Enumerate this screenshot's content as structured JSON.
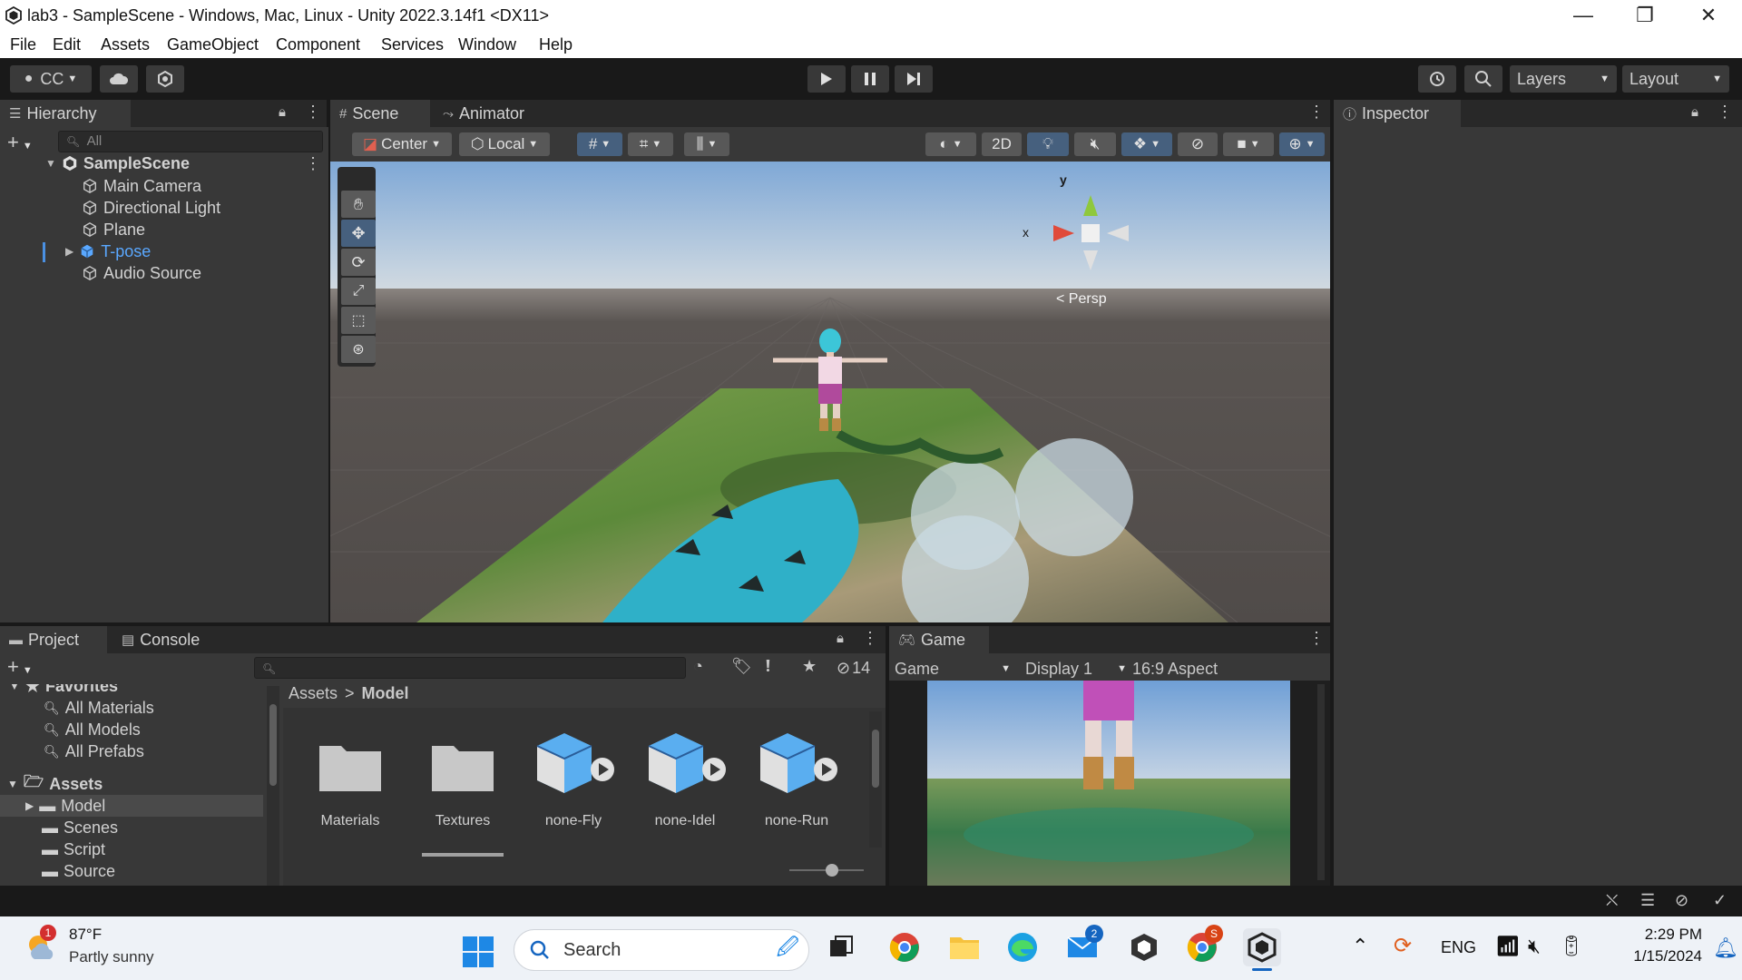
{
  "window": {
    "title": "lab3 - SampleScene - Windows, Mac, Linux - Unity 2022.3.14f1 <DX11>",
    "minimize_glyph": "—",
    "maximize_glyph": "❐",
    "close_glyph": "✕"
  },
  "menu": [
    "File",
    "Edit",
    "Assets",
    "GameObject",
    "Component",
    "Services",
    "Window",
    "Help"
  ],
  "toolbar": {
    "account_label": "CC",
    "layers_label": "Layers",
    "layout_label": "Layout"
  },
  "hierarchy": {
    "tab_label": "Hierarchy",
    "search_placeholder": "All",
    "scene_name": "SampleScene",
    "items": [
      "Main Camera",
      "Directional Light",
      "Plane",
      "T-pose",
      "Audio Source"
    ]
  },
  "scene_view": {
    "tabs": [
      "Scene",
      "Animator"
    ],
    "pivot_label": "Center",
    "space_label": "Local",
    "mode_2d_label": "2D",
    "gizmo_y": "y",
    "gizmo_x": "x",
    "persp_label": "< Persp"
  },
  "inspector": {
    "tab_label": "Inspector"
  },
  "project": {
    "tabs": [
      "Project",
      "Console"
    ],
    "hidden_count": "14",
    "favorites_header": "Favorites",
    "favorites": [
      "All Materials",
      "All Models",
      "All Prefabs"
    ],
    "assets_root": "Assets",
    "folders": [
      "Model",
      "Scenes",
      "Script",
      "Source"
    ],
    "breadcrumb": [
      "Assets",
      "Model"
    ],
    "breadcrumb_sep": ">",
    "items": [
      {
        "name": "Materials",
        "kind": "folder"
      },
      {
        "name": "Textures",
        "kind": "folder"
      },
      {
        "name": "none-Fly",
        "kind": "model"
      },
      {
        "name": "none-Idel",
        "kind": "model"
      },
      {
        "name": "none-Run",
        "kind": "model"
      }
    ]
  },
  "game_view": {
    "tab_label": "Game",
    "mode_label": "Game",
    "display_label": "Display 1",
    "aspect_label": "16:9 Aspect"
  },
  "taskbar": {
    "weather_temp": "87°F",
    "weather_desc": "Partly sunny",
    "weather_badge": "1",
    "search_label": "Search",
    "mail_badge": "2",
    "chrome_badge": "S",
    "language": "ENG",
    "time": "2:29 PM",
    "date": "1/15/2024"
  },
  "colors": {
    "accent": "#4a90e2",
    "selected_text": "#5aa8ff",
    "panel": "#383838",
    "background": "#191919"
  }
}
